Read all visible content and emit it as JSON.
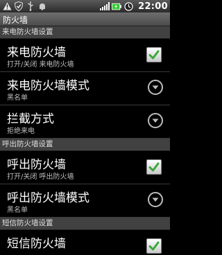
{
  "status_bar": {
    "time": "22:00"
  },
  "title_bar": {
    "title": "防火墙"
  },
  "sections": [
    {
      "header": "来电防火墙设置",
      "items": [
        {
          "title": "来电防火墙",
          "summary": "打开/关闭 来电防火墙",
          "widget": "checkbox",
          "checked": true
        },
        {
          "title": "来电防火墙模式",
          "summary": "黑名单",
          "widget": "dropdown"
        },
        {
          "title": "拦截方式",
          "summary": "拒绝来电",
          "widget": "dropdown"
        }
      ]
    },
    {
      "header": "呼出防火墙设置",
      "items": [
        {
          "title": "呼出防火墙",
          "summary": "打开/关闭 呼出防火墙",
          "widget": "checkbox",
          "checked": true
        },
        {
          "title": "呼出防火墙模式",
          "summary": "黑名单",
          "widget": "dropdown"
        }
      ]
    },
    {
      "header": "短信防火墙设置",
      "items": [
        {
          "title": "短信防火墙",
          "summary": "",
          "widget": "checkbox",
          "checked": true
        }
      ]
    }
  ],
  "colors": {
    "check_green": "#3aa83a",
    "section_bg": "#414141",
    "title_bar_bg": "#5c5c5c"
  }
}
